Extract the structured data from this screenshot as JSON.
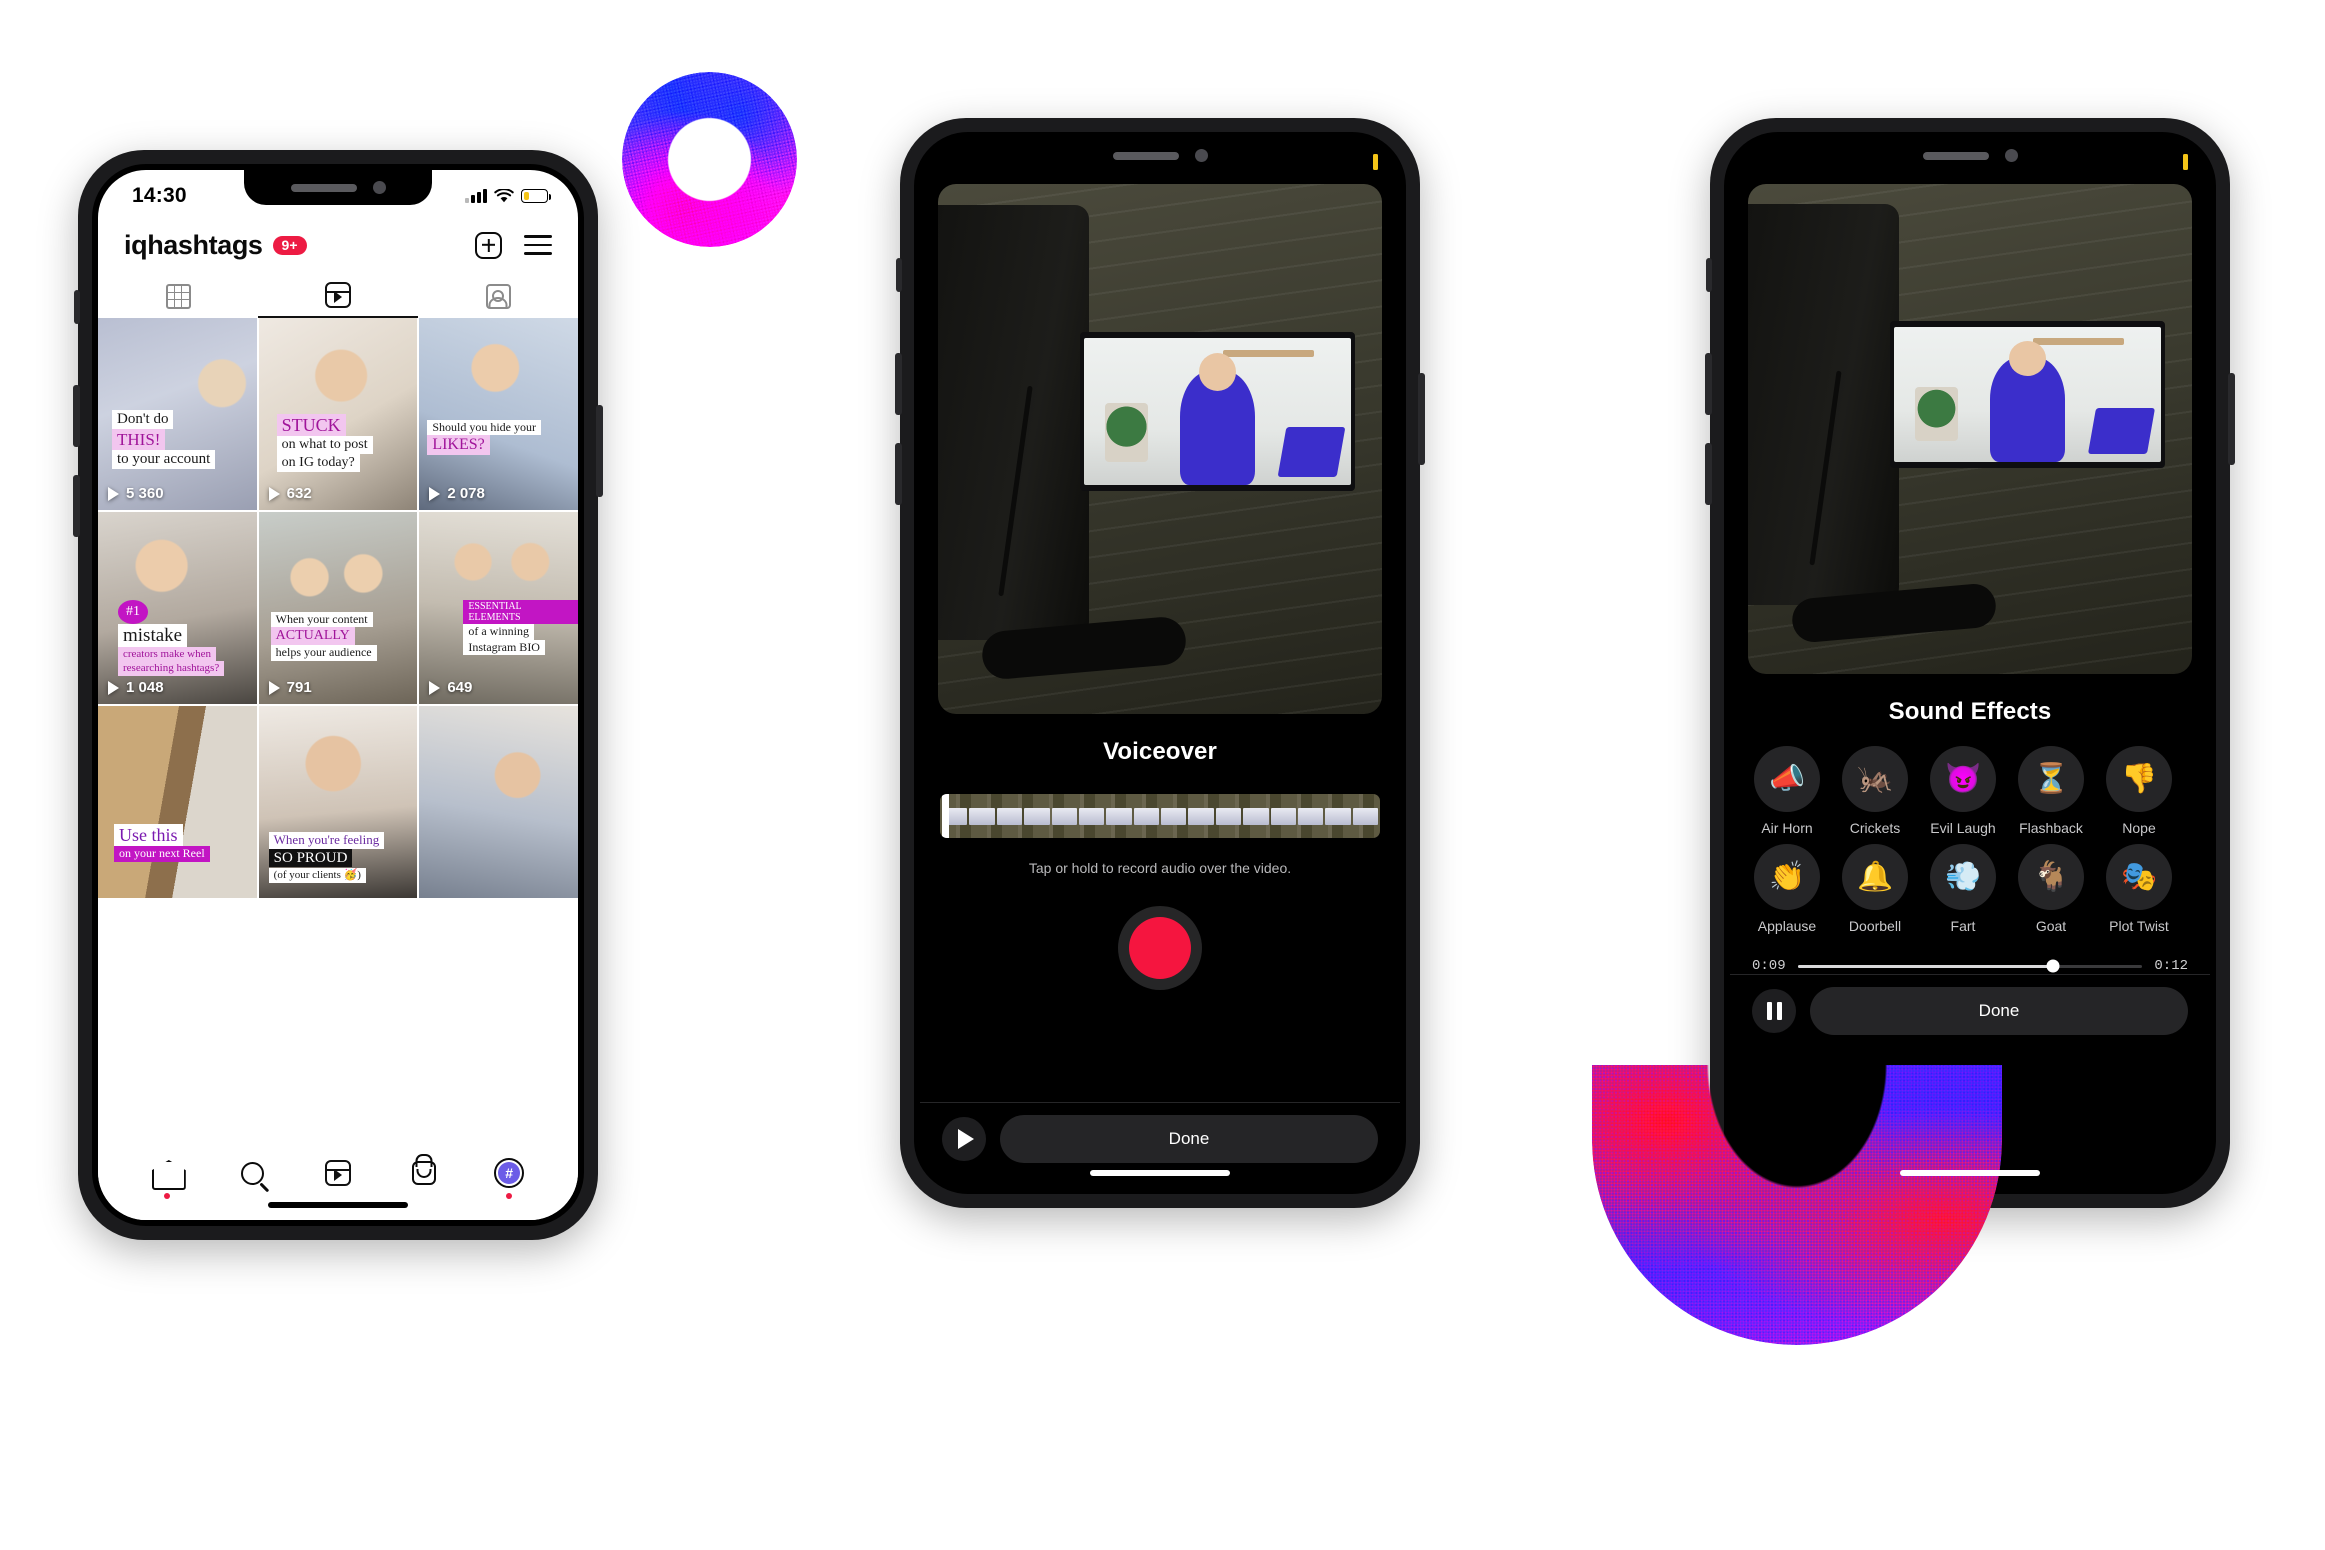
{
  "phone1": {
    "status": {
      "time": "14:30",
      "signal_icon": "cellular-bars-icon",
      "wifi_icon": "wifi-icon",
      "battery_icon": "battery-low-icon"
    },
    "header": {
      "username": "iqhashtags",
      "badge": "9+",
      "add_icon": "plus-square-icon",
      "menu_icon": "hamburger-menu-icon"
    },
    "tabs": [
      {
        "name": "grid",
        "icon": "grid-icon",
        "active": false
      },
      {
        "name": "reels",
        "icon": "reels-icon",
        "active": true
      },
      {
        "name": "tagged",
        "icon": "tagged-person-icon",
        "active": false
      }
    ],
    "grid": [
      {
        "plays": "5 360",
        "caption": [
          {
            "text": "Don't do",
            "style": "w"
          },
          {
            "text": "THIS!",
            "style": "p"
          },
          {
            "text": "to your account",
            "style": "w"
          }
        ]
      },
      {
        "plays": "632",
        "caption": [
          {
            "text": "STUCK",
            "style": "p"
          },
          {
            "text": "on what to post",
            "style": "w"
          },
          {
            "text": "on IG today?",
            "style": "w"
          }
        ]
      },
      {
        "plays": "2 078",
        "caption": [
          {
            "text": "Should you hide your",
            "style": "w"
          },
          {
            "text": "LIKES?",
            "style": "p"
          }
        ]
      },
      {
        "plays": "1 048",
        "caption": [
          {
            "text": "#1",
            "style": "m"
          },
          {
            "text": "mistake",
            "style": "w"
          },
          {
            "text": "creators make when",
            "style": "p"
          },
          {
            "text": "researching hashtags?",
            "style": "p"
          }
        ]
      },
      {
        "plays": "791",
        "caption": [
          {
            "text": "When your content",
            "style": "w"
          },
          {
            "text": "ACTUALLY",
            "style": "p"
          },
          {
            "text": "helps your audience",
            "style": "w"
          }
        ]
      },
      {
        "plays": "649",
        "caption": [
          {
            "text": "ESSENTIAL ELEMENTS",
            "style": "m"
          },
          {
            "text": "of a winning",
            "style": "w"
          },
          {
            "text": "Instagram BIO",
            "style": "w"
          }
        ]
      },
      {
        "plays": "",
        "caption": [
          {
            "text": "Use this",
            "style": "w"
          },
          {
            "text": "on your next Reel",
            "style": "m"
          }
        ]
      },
      {
        "plays": "",
        "caption": [
          {
            "text": "When you're feeling",
            "style": "w"
          },
          {
            "text": "SO PROUD",
            "style": "k"
          },
          {
            "text": "(of your clients 🥳)",
            "style": "w"
          }
        ]
      },
      {
        "plays": "",
        "caption": []
      }
    ],
    "bottom_nav": [
      {
        "name": "home",
        "icon": "home-icon",
        "has_dot": true
      },
      {
        "name": "search",
        "icon": "search-icon",
        "has_dot": false
      },
      {
        "name": "reels",
        "icon": "reels-icon",
        "has_dot": false
      },
      {
        "name": "shop",
        "icon": "shopping-bag-icon",
        "has_dot": false
      },
      {
        "name": "profile",
        "icon": "profile-avatar-icon",
        "avatar_glyph": "#",
        "has_dot": true
      }
    ]
  },
  "phone2": {
    "title": "Voiceover",
    "hint": "Tap or hold to record audio over the video.",
    "record_icon": "record-button-icon",
    "play_icon": "play-icon",
    "done_label": "Done"
  },
  "phone3": {
    "title": "Sound Effects",
    "effects_row1": [
      {
        "label": "Air Horn",
        "emoji": "📣"
      },
      {
        "label": "Crickets",
        "emoji": "🦗"
      },
      {
        "label": "Evil Laugh",
        "emoji": "😈"
      },
      {
        "label": "Flashback",
        "emoji": "⏳"
      },
      {
        "label": "Nope",
        "emoji": "👎"
      }
    ],
    "effects_row2": [
      {
        "label": "Applause",
        "emoji": "👏"
      },
      {
        "label": "Doorbell",
        "emoji": "🔔"
      },
      {
        "label": "Fart",
        "emoji": "💨"
      },
      {
        "label": "Goat",
        "emoji": "🐐"
      },
      {
        "label": "Plot Twist",
        "emoji": "🎭"
      }
    ],
    "scrubber": {
      "current_time": "0:09",
      "total_time": "0:12"
    },
    "pause_icon": "pause-icon",
    "done_label": "Done"
  },
  "decor": {
    "torus": "purple-blue-torus-shape",
    "arc": "blue-red-u-arc-shape"
  }
}
